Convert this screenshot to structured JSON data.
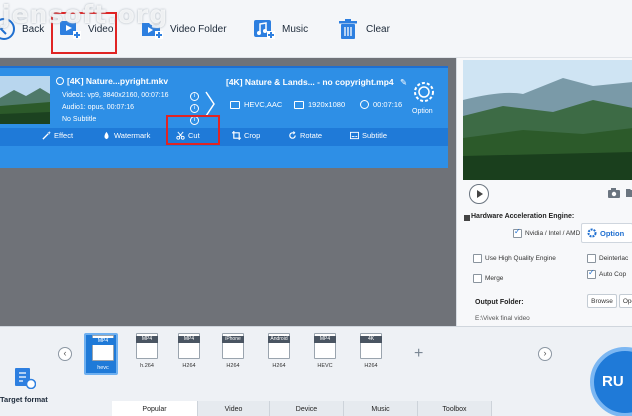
{
  "watermark": "jensoft.org",
  "toolbar": {
    "back_label": "Back",
    "video_label": "Video",
    "video_folder_label": "Video Folder",
    "music_label": "Music",
    "clear_label": "Clear"
  },
  "card": {
    "src_title": "[4K] Nature...pyright.mkv",
    "video_info": "Video1: vp9, 3840x2160, 00:07:16",
    "audio_info": "Audio1: opus, 00:07:16",
    "subtitle_info": "No Subtitle",
    "dst_title": "[4K] Nature & Lands... - no copyright.mp4",
    "codec": "HEVC,AAC",
    "resolution": "1920x1080",
    "duration": "00:07:16",
    "option_label": "Option"
  },
  "edit": {
    "effect": "Effect",
    "watermark": "Watermark",
    "cut": "Cut",
    "crop": "Crop",
    "rotate": "Rotate",
    "subtitle": "Subtitle"
  },
  "preview": {
    "hw_title": "Hardware Acceleration Engine:",
    "nvidia": "Nvidia / Intel / AMD",
    "option_btn": "Option",
    "high_quality": "Use High Quality Engine",
    "deinterlace": "Deinterlac",
    "merge": "Merge",
    "auto_copy": "Auto Cop",
    "output_label": "Output Folder:",
    "output_path": "E:\\Vivek final video",
    "browse": "Browse",
    "open": "Ope"
  },
  "formats": [
    {
      "tag": "MP4",
      "sub": "hevc",
      "selected": true
    },
    {
      "tag": "MP4",
      "sub": "h.264",
      "selected": false
    },
    {
      "tag": "MP4",
      "sub": "H264",
      "selected": false
    },
    {
      "tag": "iPhone",
      "sub": "H264",
      "selected": false
    },
    {
      "tag": "Android",
      "sub": "H264",
      "selected": false
    },
    {
      "tag": "MP4",
      "sub": "HEVC",
      "selected": false
    },
    {
      "tag": "4K",
      "sub": "H264",
      "selected": false
    }
  ],
  "bottom": {
    "target_format": "Target format",
    "run": "RU",
    "tabs": [
      "Popular",
      "Video",
      "Device",
      "Music",
      "Toolbox"
    ]
  },
  "colors": {
    "accent": "#1f7ad8",
    "card": "#2e8fe6",
    "highlight": "#e02424"
  }
}
